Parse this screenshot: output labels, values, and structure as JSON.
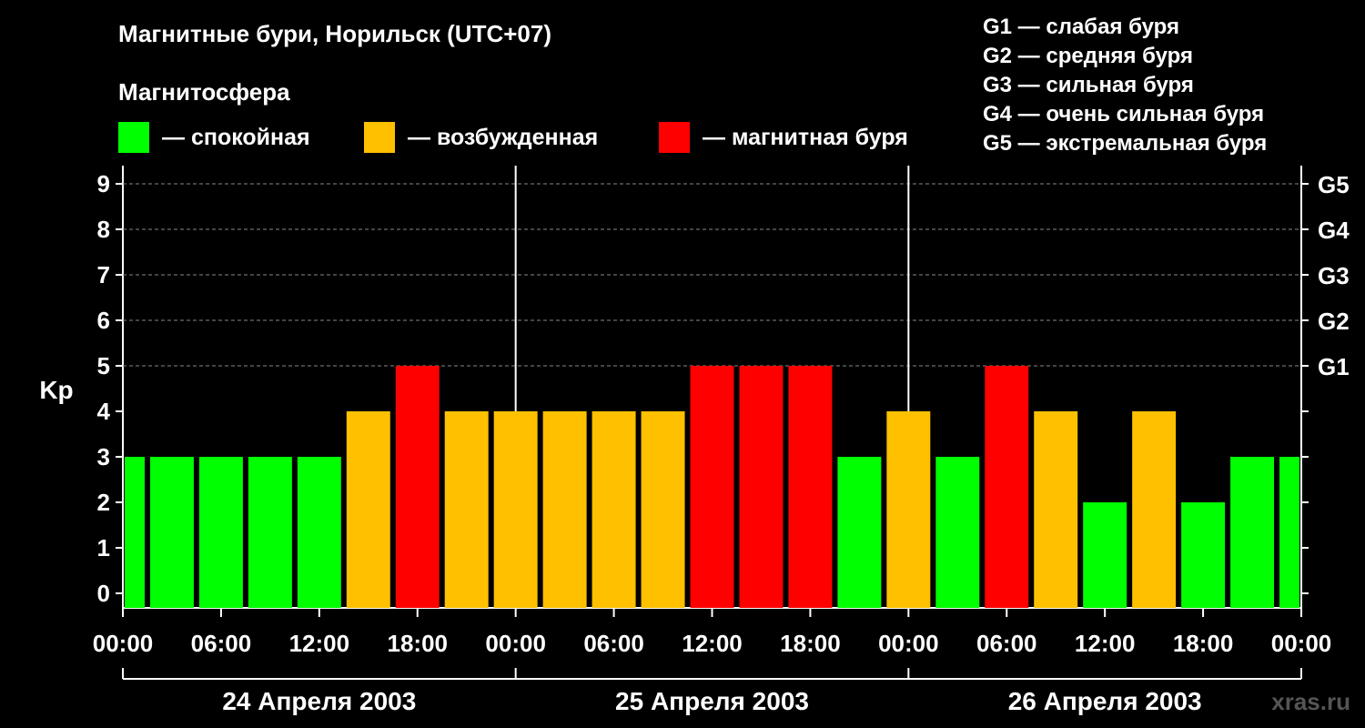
{
  "title": "Магнитные бури, Норильск (UTC+07)",
  "legend": {
    "heading": "Магнитосфера",
    "items": [
      {
        "label": "— спокойная",
        "color": "#00ff00"
      },
      {
        "label": "— возбужденная",
        "color": "#ffc000"
      },
      {
        "label": "— магнитная буря",
        "color": "#ff0000"
      }
    ]
  },
  "scale_legend": [
    "G1 — слабая буря",
    "G2 — средняя буря",
    "G3 — сильная буря",
    "G4 — очень сильная буря",
    "G5 — экстремальная буря"
  ],
  "watermark": "xras.ru",
  "chart_data": {
    "type": "bar",
    "ylabel": "Kp",
    "ylim": [
      0,
      9
    ],
    "y_ticks": [
      "0",
      "1",
      "2",
      "3",
      "4",
      "5",
      "6",
      "7",
      "8",
      "9"
    ],
    "right_ticks": [
      {
        "value": 5,
        "label": "G1"
      },
      {
        "value": 6,
        "label": "G2"
      },
      {
        "value": 7,
        "label": "G3"
      },
      {
        "value": 8,
        "label": "G4"
      },
      {
        "value": 9,
        "label": "G5"
      }
    ],
    "x_tick_labels": [
      "00:00",
      "06:00",
      "12:00",
      "18:00",
      "00:00",
      "06:00",
      "12:00",
      "18:00",
      "00:00",
      "06:00",
      "12:00",
      "18:00",
      "00:00"
    ],
    "days": [
      "24 Апреля 2003",
      "25 Апреля 2003",
      "26 Апреля 2003"
    ],
    "grid": "dashed horizontal",
    "values": [
      3,
      3,
      3,
      3,
      3,
      4,
      5,
      4,
      4,
      4,
      4,
      4,
      5,
      5,
      5,
      3,
      4,
      3,
      5,
      4,
      2,
      4,
      2,
      3,
      3
    ],
    "colors": {
      "quiet": "#00ff00",
      "active": "#ffc000",
      "storm": "#ff0000"
    }
  }
}
